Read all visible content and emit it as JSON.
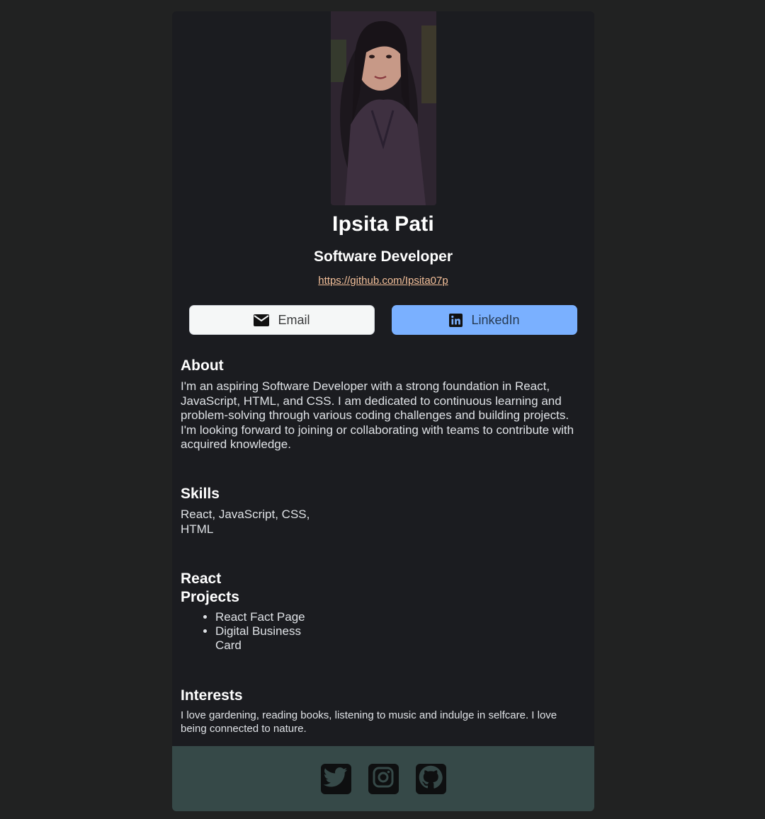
{
  "profile": {
    "name": "Ipsita Pati",
    "role": "Software Developer",
    "github_url": "https://github.com/Ipsita07p"
  },
  "buttons": {
    "email_label": "Email",
    "linkedin_label": "LinkedIn"
  },
  "about": {
    "title": "About",
    "text": "I'm an aspiring Software Developer with a strong foundation in React, JavaScript, HTML, and CSS. I am dedicated to continuous learning and problem-solving through various coding challenges and building projects. I'm looking forward to joining or collaborating with teams to contribute with acquired knowledge."
  },
  "skills": {
    "title": "Skills",
    "text": "React, JavaScript, CSS, HTML"
  },
  "projects": {
    "title": "React Projects",
    "items": [
      "React Fact Page",
      "Digital Business Card"
    ]
  },
  "interests": {
    "title": "Interests",
    "text": "I love gardening, reading books, listening to music and indulge in selfcare. I love being connected to nature."
  },
  "footer": {
    "icons": [
      "twitter-icon",
      "instagram-icon",
      "github-icon"
    ]
  },
  "colors": {
    "page_bg": "#212222",
    "card_bg": "#1b1c20",
    "footer_bg": "#364948",
    "link": "#f3bf99",
    "linkedin_button": "#7ab0ff",
    "email_button": "#f5f7f7"
  }
}
